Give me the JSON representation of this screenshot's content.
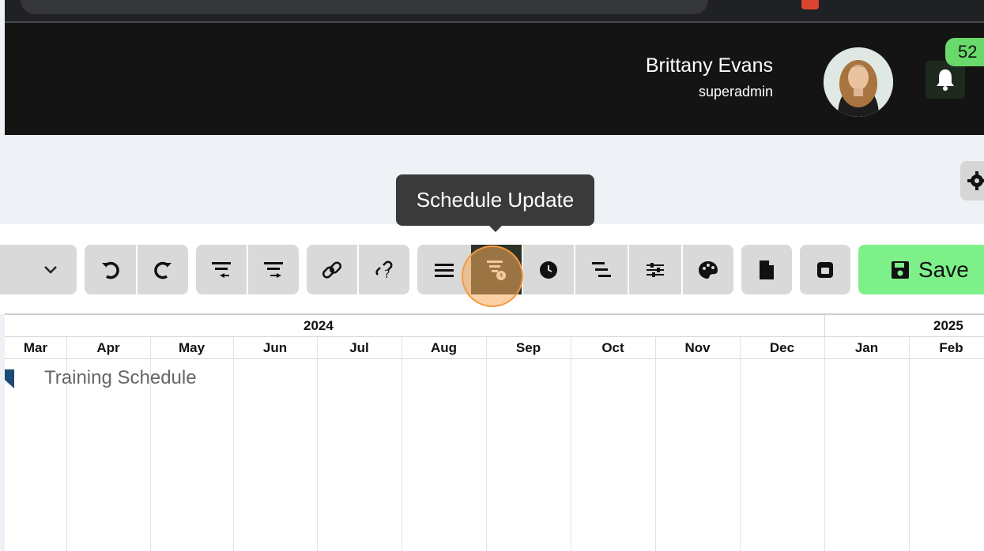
{
  "header": {
    "user_name": "Brittany Evans",
    "user_role": "superadmin",
    "notification_count": "52"
  },
  "tooltip": {
    "text": "Schedule Update"
  },
  "toolbar": {
    "buttons": [
      {
        "name": "view-dropdown",
        "icon": "chevron-down-icon"
      },
      {
        "name": "undo-button",
        "icon": "undo-icon"
      },
      {
        "name": "redo-button",
        "icon": "redo-icon"
      },
      {
        "name": "outdent-button",
        "icon": "outdent-icon"
      },
      {
        "name": "indent-button",
        "icon": "indent-icon"
      },
      {
        "name": "link-button",
        "icon": "link-icon"
      },
      {
        "name": "unlink-button",
        "icon": "unlink-icon"
      },
      {
        "name": "menu-button",
        "icon": "lines-icon"
      },
      {
        "name": "schedule-update-button",
        "icon": "filter-clock-icon",
        "active": true
      },
      {
        "name": "clock-button",
        "icon": "clock-icon"
      },
      {
        "name": "tasks-button",
        "icon": "indent-lines-icon"
      },
      {
        "name": "settings-sliders-button",
        "icon": "sliders-icon"
      },
      {
        "name": "palette-button",
        "icon": "palette-icon"
      },
      {
        "name": "file-button",
        "icon": "file-icon"
      },
      {
        "name": "save-disk-button",
        "icon": "floppy-icon"
      }
    ],
    "save_label": "Save"
  },
  "gantt": {
    "years": [
      "2024",
      "2025"
    ],
    "months": [
      "Mar",
      "Apr",
      "May",
      "Jun",
      "Jul",
      "Aug",
      "Sep",
      "Oct",
      "Nov",
      "Dec",
      "Jan",
      "Feb"
    ],
    "task": "Training Schedule"
  },
  "colors": {
    "header_bg": "#141414",
    "save_bg": "#7ef08a",
    "active_btn": "#2b3328",
    "badge": "#68d96a",
    "task_marker": "#1c4a73"
  }
}
